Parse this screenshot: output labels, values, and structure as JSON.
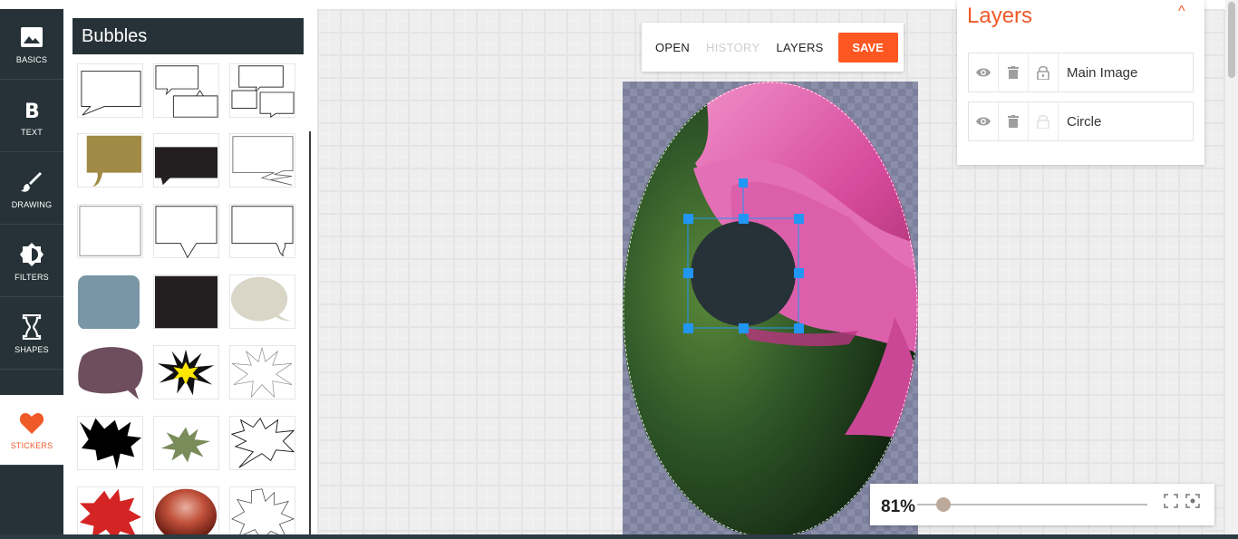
{
  "rail": {
    "items": [
      {
        "label": "BASICS",
        "icon": "image-icon"
      },
      {
        "label": "TEXT",
        "icon": "bold-b-icon"
      },
      {
        "label": "DRAWING",
        "icon": "brush-icon"
      },
      {
        "label": "FILTERS",
        "icon": "brightness-icon"
      },
      {
        "label": "SHAPES",
        "icon": "hourglass-icon"
      },
      {
        "label": "STICKERS",
        "icon": "heart-icon"
      }
    ],
    "active": "STICKERS"
  },
  "panel": {
    "title": "Bubbles",
    "stickers": [
      "speech-bubble-outline",
      "double-bubble-outline",
      "triple-bubble-outline",
      "olive-bubble",
      "black-bubble",
      "jagged-tail-bubble",
      "plain-rectangle",
      "square-tail-bubble",
      "wavy-tail-bubble",
      "blue-gray-rounded",
      "black-rectangle",
      "beige-thought-bubble",
      "mauve-bubble",
      "yellow-burst",
      "outline-burst",
      "black-spiky-bubble",
      "olive-burst",
      "spiky-outline-bubble",
      "red-splat",
      "glossy-red-oval",
      "outline-spike"
    ]
  },
  "toolbar": {
    "open": "OPEN",
    "history": "HISTORY",
    "layers": "LAYERS",
    "save": "SAVE"
  },
  "layers": {
    "title": "Layers",
    "toggle": "^",
    "items": [
      {
        "name": "Main Image",
        "locked": true
      },
      {
        "name": "Circle",
        "locked": false
      }
    ]
  },
  "zoom": {
    "value": "81%",
    "level": 0.81
  },
  "colors": {
    "accent": "#f05a28",
    "save": "#ff5722",
    "rail": "#263238",
    "circle": "#263238",
    "handle": "#2196f3"
  }
}
